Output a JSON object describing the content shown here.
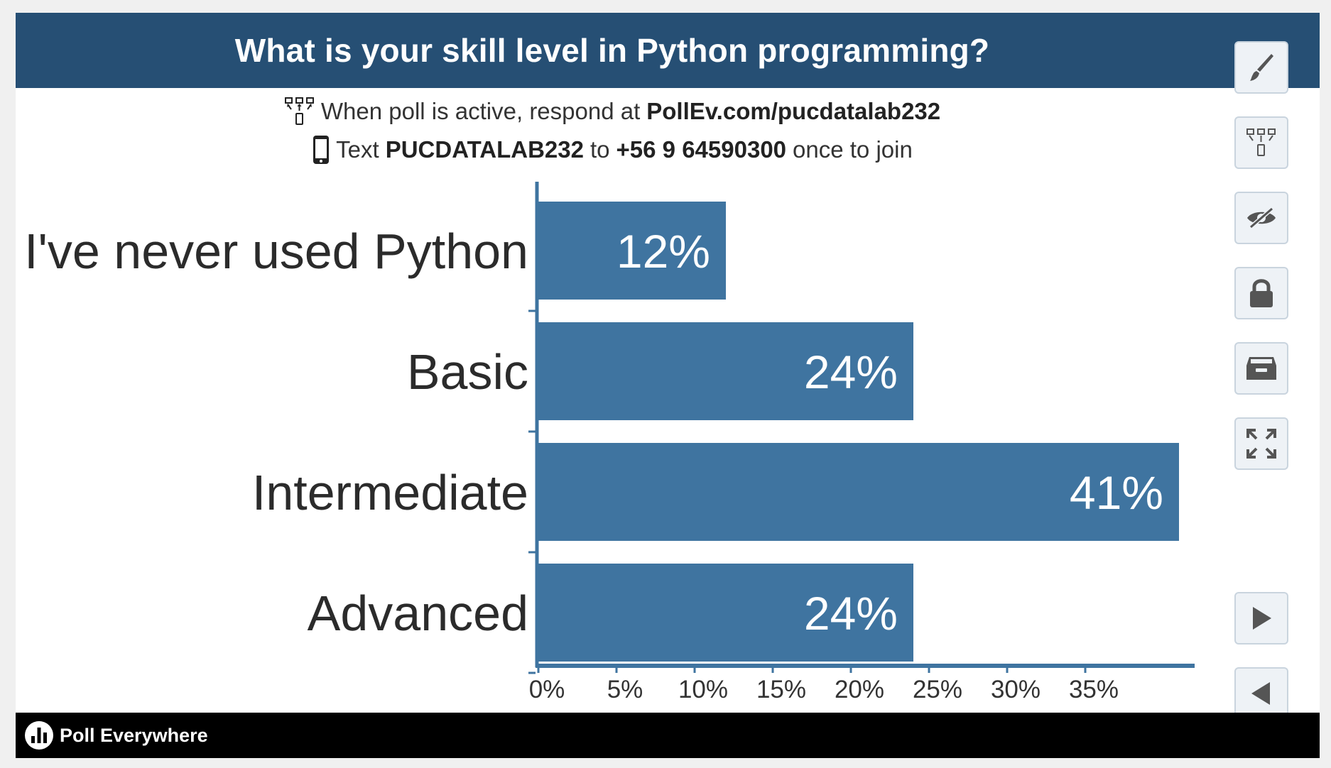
{
  "poll": {
    "title": "What is your skill level in Python programming?",
    "instructions": {
      "web_prefix": "When poll is active, respond at",
      "web_url": "PollEv.com/pucdatalab232",
      "text_prefix": "Text",
      "text_code": "PUCDATALAB232",
      "text_to": "to",
      "text_number": "+56 9 64590300",
      "text_suffix": "once to join"
    }
  },
  "chart_data": {
    "type": "bar",
    "orientation": "horizontal",
    "categories": [
      "I've never used Python",
      "Basic",
      "Intermediate",
      "Advanced"
    ],
    "values": [
      12,
      24,
      41,
      24
    ],
    "value_labels": [
      "12%",
      "24%",
      "41%",
      "24%"
    ],
    "xticks": [
      "0%",
      "5%",
      "10%",
      "15%",
      "20%",
      "25%",
      "30%",
      "35%"
    ],
    "xlim": [
      0,
      42
    ],
    "grid": false,
    "bar_color": "#3f74a0",
    "axis_color": "#3f74a0"
  },
  "sidebar": {
    "buttons": [
      {
        "icon": "brush-icon"
      },
      {
        "icon": "response-options-icon"
      },
      {
        "icon": "hide-responses-icon"
      },
      {
        "icon": "lock-icon"
      },
      {
        "icon": "archive-icon"
      },
      {
        "icon": "fullscreen-icon"
      },
      {
        "icon": "next-icon"
      },
      {
        "icon": "previous-icon"
      }
    ]
  },
  "footer": {
    "brand": "Poll Everywhere"
  },
  "colors": {
    "header_bg": "#264f74",
    "footer_bg": "#000000",
    "bar": "#3f74a0",
    "button_border": "#c9d4de",
    "icon": "#555555"
  }
}
